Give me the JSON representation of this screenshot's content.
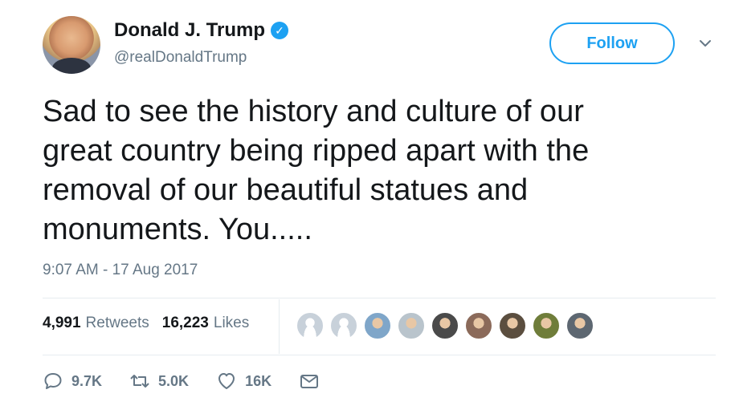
{
  "author": {
    "name": "Donald J. Trump",
    "handle": "@realDonaldTrump",
    "verified_icon": "verified-badge-icon"
  },
  "follow_label": "Follow",
  "tweet": {
    "text": "Sad to see the history and culture of our\ngreat country being ripped apart with the\nremoval of our beautiful statues and\nmonuments. You.....",
    "timestamp": "9:07 AM - 17 Aug 2017"
  },
  "stats": {
    "retweets_count": "4,991",
    "retweets_label": "Retweets",
    "likes_count": "16,223",
    "likes_label": "Likes"
  },
  "likers": [
    {
      "icon": "default-avatar",
      "color": "#c8d1da"
    },
    {
      "icon": "default-avatar",
      "color": "#c8d1da"
    },
    {
      "icon": "user-avatar",
      "color": "#7fa6c9"
    },
    {
      "icon": "user-avatar",
      "color": "#b9c4cc"
    },
    {
      "icon": "user-avatar",
      "color": "#4a4a4a"
    },
    {
      "icon": "user-avatar",
      "color": "#8b6a5a"
    },
    {
      "icon": "user-avatar",
      "color": "#5b4e3f"
    },
    {
      "icon": "user-avatar",
      "color": "#6f7d3a"
    },
    {
      "icon": "user-avatar",
      "color": "#5d6771"
    }
  ],
  "actions": {
    "reply_count": "9.7K",
    "retweet_count": "5.0K",
    "like_count": "16K"
  },
  "colors": {
    "accent": "#1da1f2",
    "secondary_text": "#657786",
    "primary_text": "#14171a",
    "divider": "#e6ecf0"
  }
}
